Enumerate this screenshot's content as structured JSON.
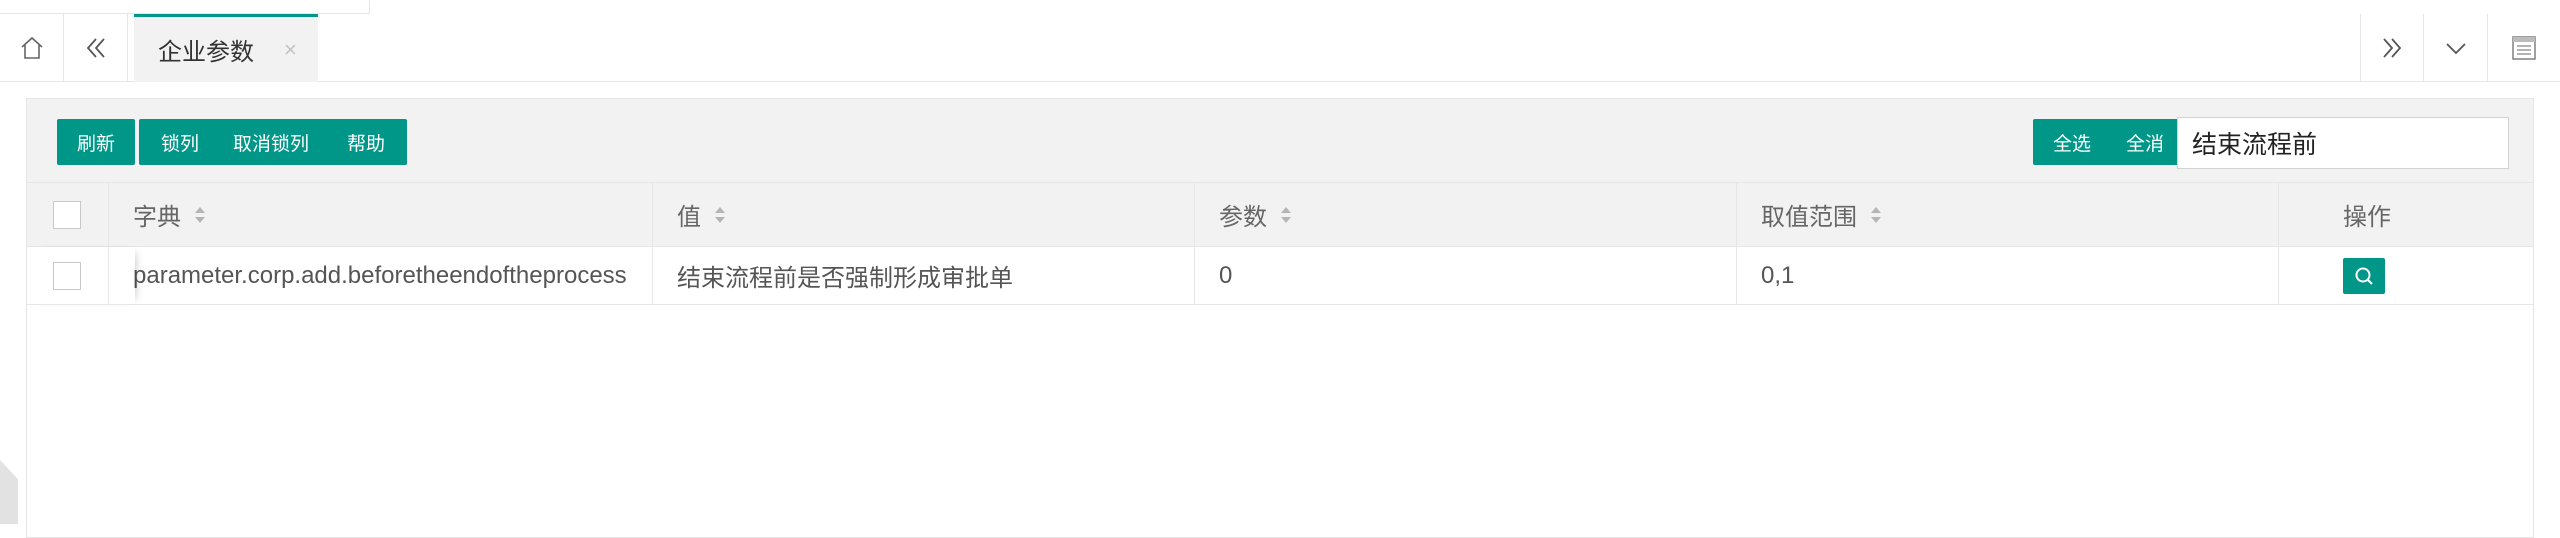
{
  "tabs": {
    "active_label": "企业参数",
    "close_glyph": "×"
  },
  "toolbar": {
    "refresh_label": "刷新",
    "lock_label": "锁列",
    "unlock_label": "取消锁列",
    "help_label": "帮助",
    "select_all_label": "全选",
    "select_none_label": "全消",
    "search_value": "结束流程前"
  },
  "table": {
    "columns": [
      "字典",
      "值",
      "参数",
      "取值范围",
      "操作"
    ],
    "rows": [
      {
        "dict": "parameter.corp.add.beforetheendoftheprocess",
        "value": "结束流程前是否强制形成审批单",
        "param": "0",
        "range": "0,1"
      }
    ]
  },
  "icons": {
    "home": "home-icon",
    "prev": "double-chevron-left-icon",
    "next": "double-chevron-right-icon",
    "down": "chevron-down-icon",
    "sheet": "sheet-icon",
    "view": "search-icon"
  },
  "colors": {
    "accent": "#009688"
  }
}
